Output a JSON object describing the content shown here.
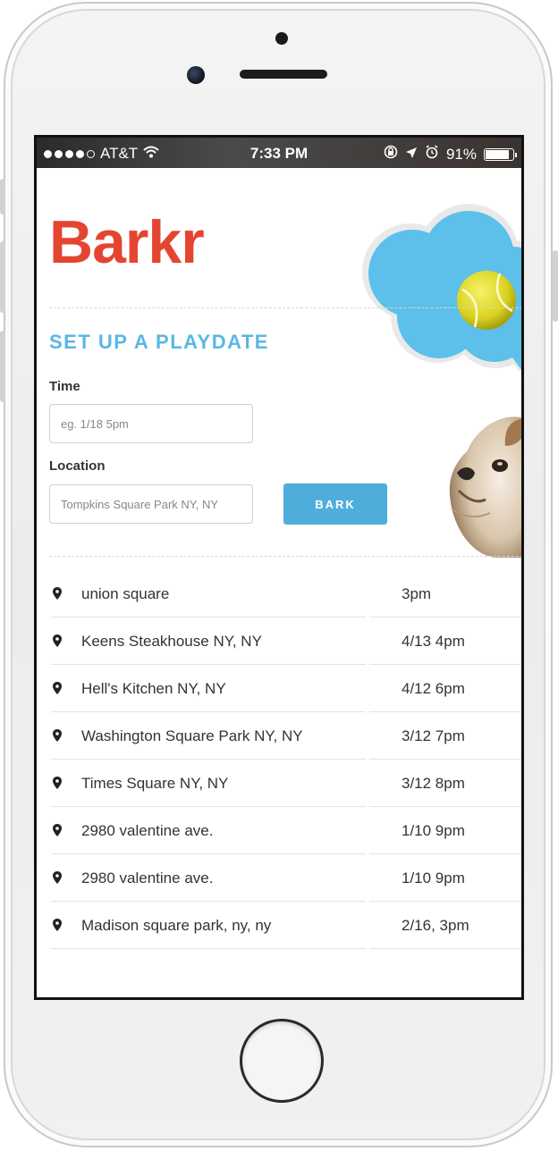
{
  "status_bar": {
    "carrier": "AT&T",
    "signal_dots_filled": 4,
    "signal_dots_total": 5,
    "time": "7:33 PM",
    "battery": "91%",
    "battery_level": 0.91
  },
  "app": {
    "logo": "Barkr",
    "section_title": "SET UP A PLAYDATE",
    "time_label": "Time",
    "time_placeholder": "eg. 1/18 5pm",
    "location_label": "Location",
    "location_placeholder": "Tompkins Square Park NY, NY",
    "bark_button": "BARK"
  },
  "playdates": [
    {
      "location": "union square",
      "time": "3pm"
    },
    {
      "location": "Keens Steakhouse NY, NY",
      "time": "4/13 4pm"
    },
    {
      "location": "Hell's Kitchen NY, NY",
      "time": "4/12 6pm"
    },
    {
      "location": "Washington Square Park NY, NY",
      "time": "3/12 7pm"
    },
    {
      "location": "Times Square NY, NY",
      "time": "3/12 8pm"
    },
    {
      "location": "2980 valentine ave.",
      "time": "1/10 9pm"
    },
    {
      "location": "2980 valentine ave.",
      "time": "1/10 9pm"
    },
    {
      "location": "Madison square park, ny, ny",
      "time": "2/16, 3pm"
    }
  ],
  "colors": {
    "brand_red": "#e44530",
    "accent_blue": "#5ab7e3",
    "button_blue": "#4eaedb",
    "cloud_blue": "#5cc0ea",
    "tennis_ball": "#e6e02a"
  },
  "icons": {
    "wifi": "wifi-icon",
    "lock_rotation": "rotation-lock-icon",
    "location_arrow": "location-arrow-icon",
    "alarm": "alarm-icon",
    "battery": "battery-icon",
    "list_pin": "map-pin-icon"
  }
}
